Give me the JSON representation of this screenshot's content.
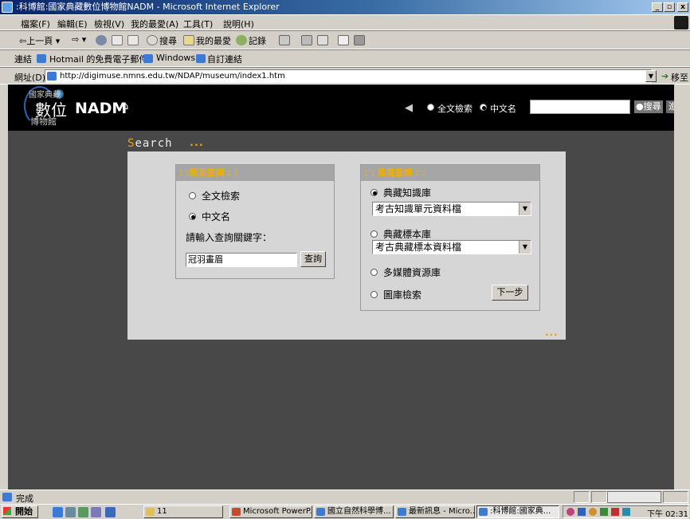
{
  "window": {
    "title": ":科博館:國家典藏數位博物館NADM - Microsoft Internet Explorer",
    "min_label": "_",
    "max_label": "▫",
    "close_label": "x"
  },
  "menubar": {
    "items": [
      "檔案(F)",
      "編輯(E)",
      "檢視(V)",
      "我的最愛(A)",
      "工具(T)",
      "說明(H)"
    ]
  },
  "toolbar": {
    "back_label": "⇦上一頁 ▾",
    "forward_label": "⇨ ▾",
    "search_label": "搜尋",
    "favorites_label": "我的最愛",
    "history_label": "記錄"
  },
  "linkbar": {
    "label": "連結",
    "links": [
      "Hotmail 的免費電子郵件",
      "Windows",
      "自訂連結"
    ]
  },
  "addressbar": {
    "label": "網址(D)",
    "url": "http://digimuse.nmns.edu.tw/NDAP/museum/index1.htm",
    "go_label": "移至"
  },
  "site_header": {
    "logo_top": "國家典藏",
    "logo_main": "數位",
    "logo_nadm": "NADM",
    "logo_bottom": "博物館",
    "radio_fulltext": "全文檢索",
    "radio_chinese": "中文名",
    "search_button": "搜尋",
    "advanced_button": "進階搜尋"
  },
  "search": {
    "title_first": "S",
    "title_rest": "earch",
    "dots": "...",
    "simple": {
      "header": ": :簡易查詢 : :",
      "opt_fulltext": "全文檢索",
      "opt_chinese": "中文名",
      "prompt": "請輸入查詢關鍵字：",
      "keyword": "冠羽畫眉",
      "query_button": "查詢"
    },
    "advanced": {
      "header": ": : 進階查詢 : :",
      "opt_knowledge": "典藏知識庫",
      "knowledge_select": "考古知識單元資料檔",
      "opt_specimen": "典藏標本庫",
      "specimen_select": "考古典藏標本資料檔",
      "opt_multimedia": "多媒體資源庫",
      "opt_image": "圖庫檢索",
      "next_button": "下一步"
    },
    "panel_dots": "..."
  },
  "statusbar": {
    "text": "完成"
  },
  "taskbar": {
    "start_label": "開始",
    "folder_task": "11",
    "tasks": [
      "Microsoft PowerP...",
      "國立自然科學博...",
      "最新訊息 - Micro...",
      ":科博館:國家典..."
    ],
    "clock": "下午 02:31"
  }
}
